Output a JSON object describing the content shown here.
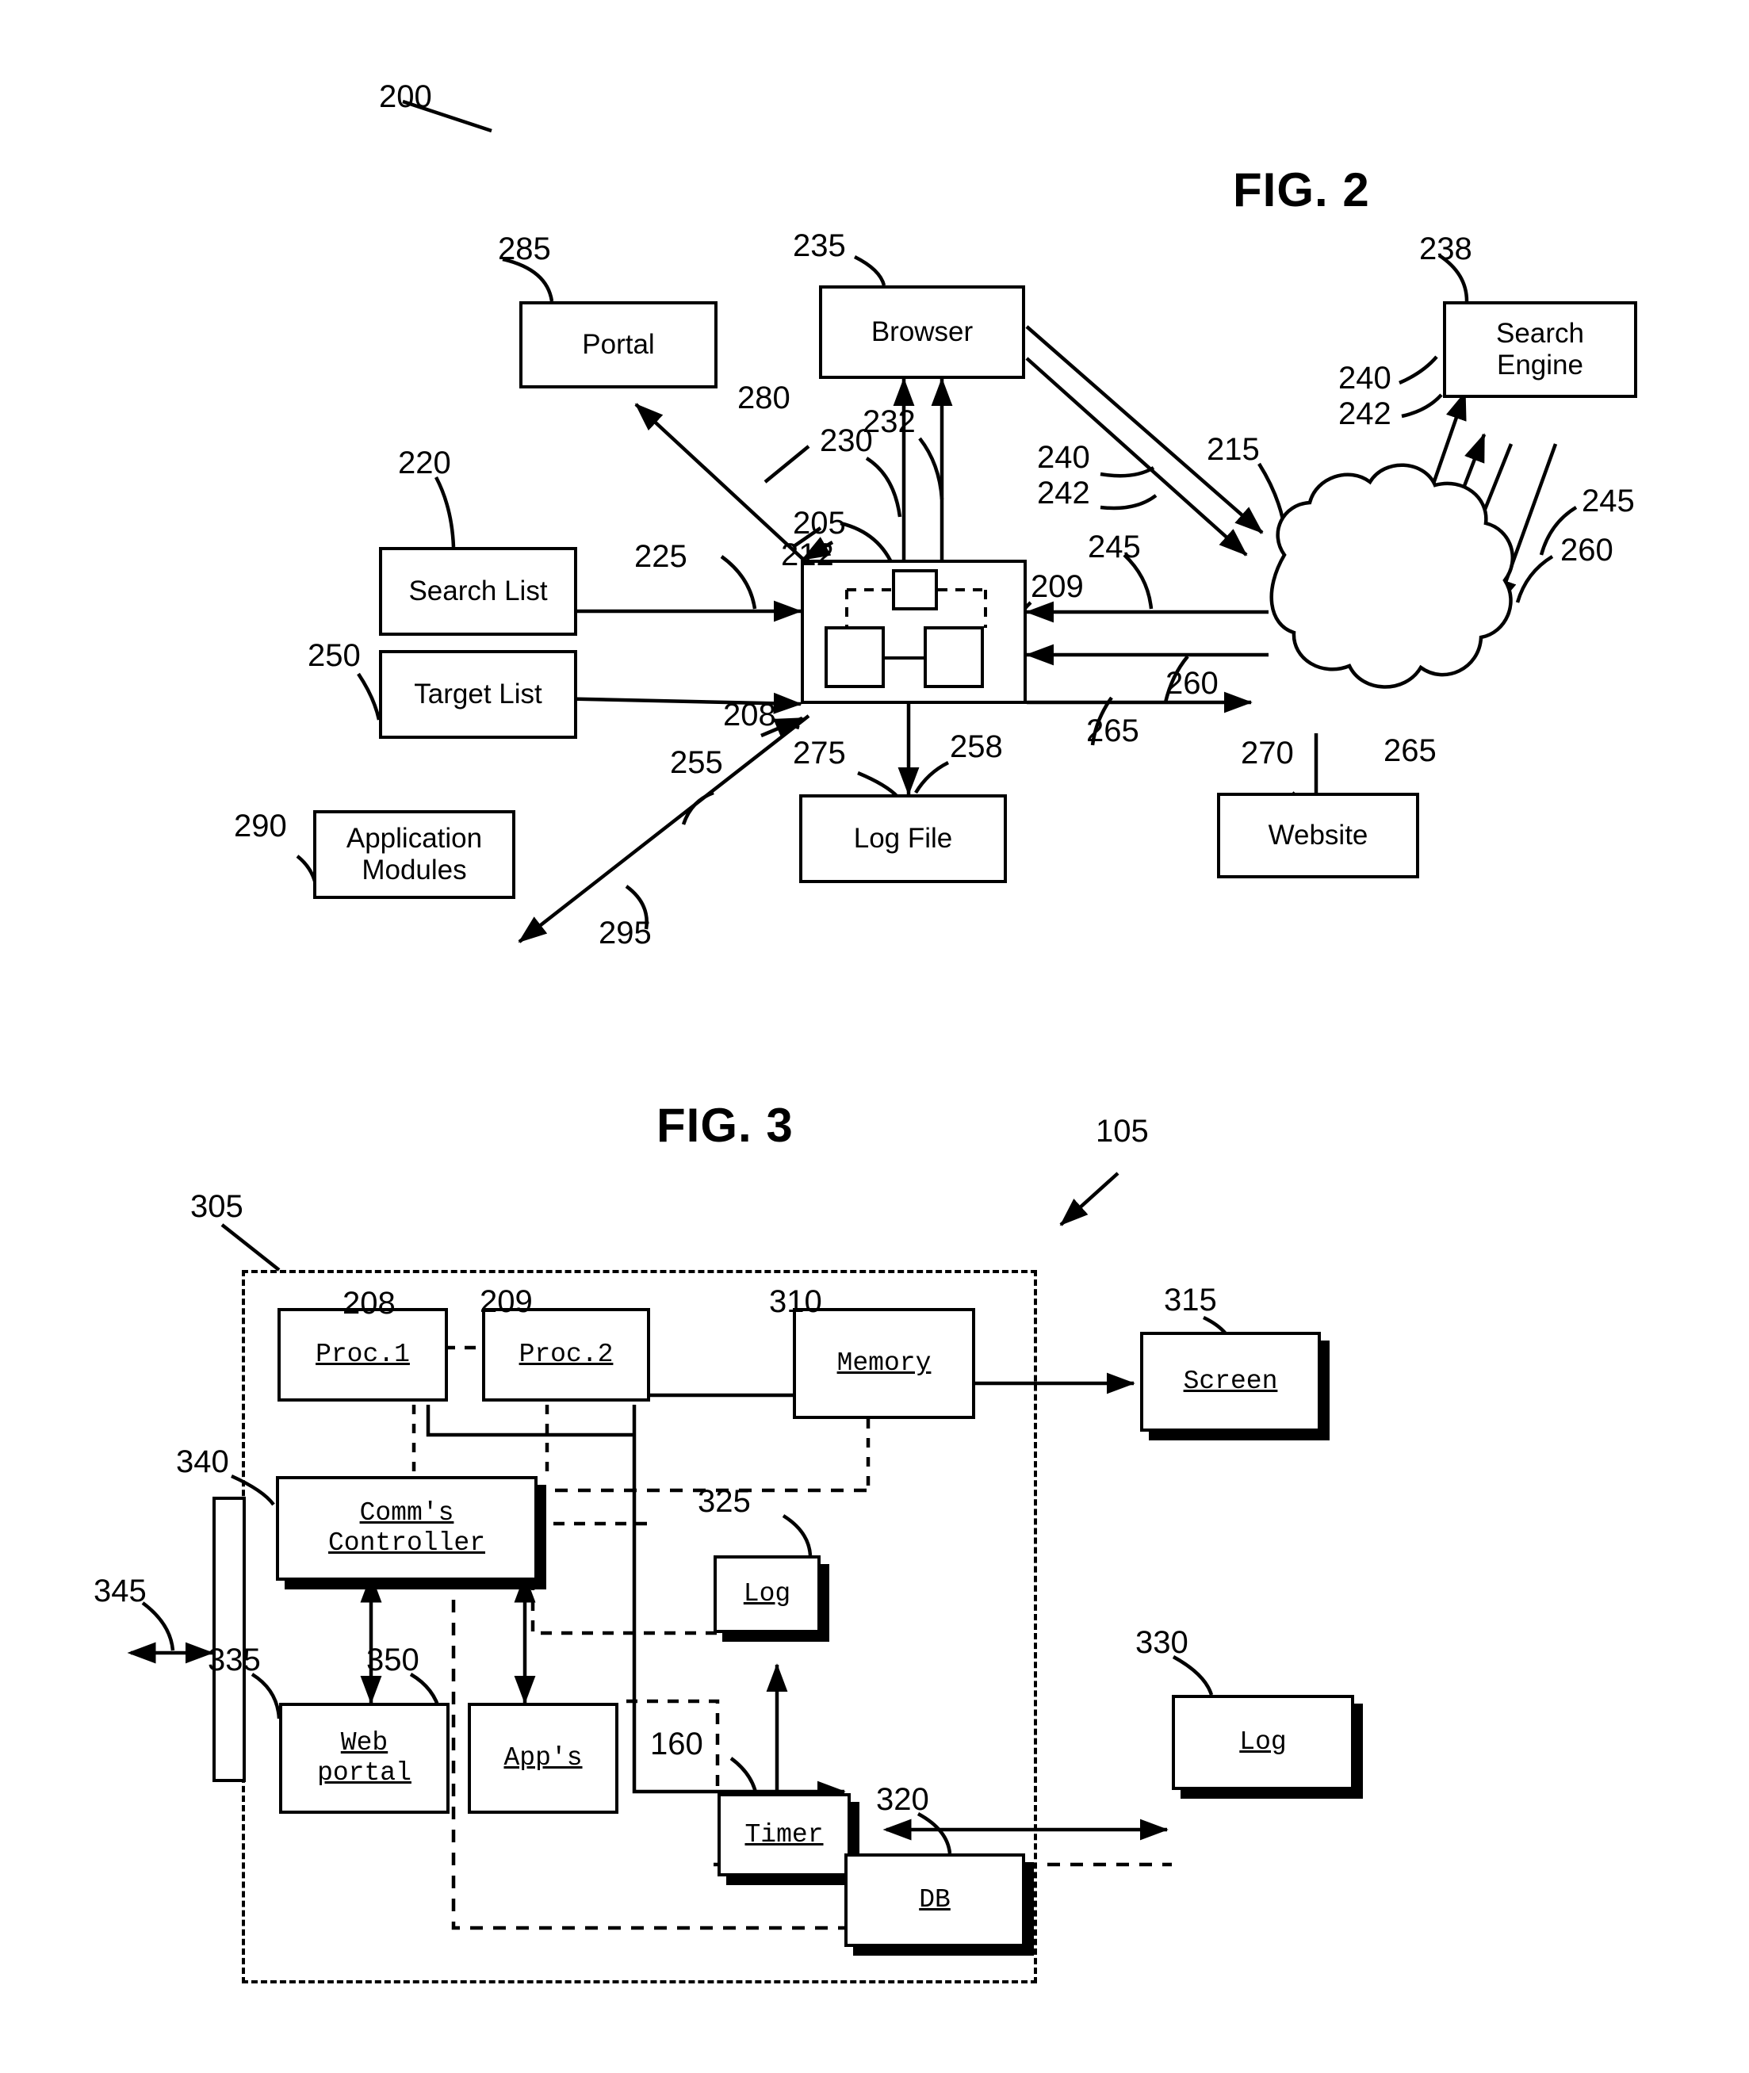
{
  "figures": [
    {
      "id": "fig2",
      "label": "FIG. 2",
      "ref": "200",
      "nodes": {
        "portal": "Portal",
        "browser": "Browser",
        "search_engine": "Search\nEngine",
        "search_list": "Search List",
        "target_list": "Target List",
        "application_modules": "Application\nModules",
        "log_file": "Log File",
        "website": "Website"
      },
      "refs": [
        "200",
        "285",
        "235",
        "238",
        "280",
        "220",
        "230",
        "232",
        "240",
        "242",
        "215",
        "205",
        "212",
        "225",
        "209",
        "245",
        "260",
        "250",
        "208",
        "255",
        "275",
        "258",
        "265",
        "290",
        "270",
        "295"
      ]
    },
    {
      "id": "fig3",
      "label": "FIG. 3",
      "ref": "105",
      "nodes": {
        "proc1": "Proc.1",
        "proc2": "Proc.2",
        "memory": "Memory",
        "screen": "Screen",
        "comms_controller": "Comm's\nController",
        "web_portal": "Web\nportal",
        "apps": "App's",
        "log_internal": "Log",
        "timer": "Timer",
        "db": "DB",
        "log_external": "Log"
      },
      "refs": [
        "105",
        "305",
        "208",
        "209",
        "310",
        "315",
        "340",
        "345",
        "325",
        "335",
        "350",
        "160",
        "330",
        "320"
      ]
    }
  ],
  "fig2": {
    "title": "FIG. 2",
    "ref_200": "200",
    "ref_285": "285",
    "ref_235": "235",
    "ref_238": "238",
    "ref_280": "280",
    "ref_220": "220",
    "ref_230": "230",
    "ref_232": "232",
    "ref_240a": "240",
    "ref_242a": "242",
    "ref_240b": "240",
    "ref_242b": "242",
    "ref_215": "215",
    "ref_205": "205",
    "ref_212": "212",
    "ref_225": "225",
    "ref_209": "209",
    "ref_245a": "245",
    "ref_245b": "245",
    "ref_260a": "260",
    "ref_260b": "260",
    "ref_250": "250",
    "ref_208": "208",
    "ref_255": "255",
    "ref_275": "275",
    "ref_258": "258",
    "ref_265a": "265",
    "ref_265b": "265",
    "ref_290": "290",
    "ref_270": "270",
    "ref_295": "295",
    "portal": "Portal",
    "browser": "Browser",
    "search_engine_l1": "Search",
    "search_engine_l2": "Engine",
    "search_list": "Search List",
    "target_list": "Target List",
    "app_modules_l1": "Application",
    "app_modules_l2": "Modules",
    "log_file": "Log File",
    "website": "Website"
  },
  "fig3": {
    "title": "FIG. 3",
    "ref_105": "105",
    "ref_305": "305",
    "ref_208": "208",
    "ref_209": "209",
    "ref_310": "310",
    "ref_315": "315",
    "ref_340": "340",
    "ref_345": "345",
    "ref_325": "325",
    "ref_335": "335",
    "ref_350": "350",
    "ref_160": "160",
    "ref_330": "330",
    "ref_320": "320",
    "proc1": "Proc.1",
    "proc2": "Proc.2",
    "memory": "Memory",
    "screen": "Screen",
    "comms_l1": "Comm's",
    "comms_l2": "Controller",
    "web_l1": "Web",
    "web_l2": "portal",
    "apps": "App's",
    "log_internal": "Log",
    "timer": "Timer",
    "db": "DB",
    "log_external": "Log"
  }
}
